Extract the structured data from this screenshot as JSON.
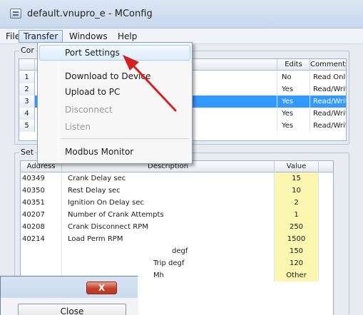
{
  "window": {
    "title": "default.vnupro_e - MConfig"
  },
  "menubar": {
    "items": [
      "File",
      "Transfer",
      "Windows",
      "Help"
    ]
  },
  "config_group": {
    "label": "Cor",
    "columns": {
      "edits": "Edits",
      "comments": "Comments"
    },
    "rows": [
      {
        "num": "1",
        "edits": "No",
        "comments": "Read Only"
      },
      {
        "num": "2",
        "edits": "Yes",
        "comments": "Read/Write"
      },
      {
        "num": "3",
        "edits": "Yes",
        "comments": "Read/Write"
      },
      {
        "num": "4",
        "edits": "Yes",
        "comments": "Read/Write"
      },
      {
        "num": "5",
        "edits": "Yes",
        "comments": "Read/Write"
      }
    ]
  },
  "settings_group": {
    "label": "Set",
    "columns": {
      "address": "Address",
      "description": "Description",
      "value": "Value"
    },
    "rows": [
      {
        "address": "40349",
        "description": "Crank Delay sec",
        "value": "15"
      },
      {
        "address": "40350",
        "description": "Rest Delay sec",
        "value": "10"
      },
      {
        "address": "40351",
        "description": "Ignition On Delay sec",
        "value": "2"
      },
      {
        "address": "40207",
        "description": "Number of Crank Attempts",
        "value": "1"
      },
      {
        "address": "40208",
        "description": "Crank Disconnect RPM",
        "value": "250"
      },
      {
        "address": "40214",
        "description": "Load Perm RPM",
        "value": "1500"
      },
      {
        "address": "",
        "description": "degf",
        "value": "150"
      },
      {
        "address": "",
        "description": "Trip degf",
        "value": "120"
      },
      {
        "address": "",
        "description": "Mh",
        "value": "Other"
      }
    ]
  },
  "transfer_menu": {
    "items": [
      {
        "label": "Port Settings",
        "state": "hover"
      },
      {
        "label": "Download to Device",
        "state": "enabled"
      },
      {
        "label": "Upload to PC",
        "state": "enabled"
      },
      {
        "label": "Disconnect",
        "state": "disabled"
      },
      {
        "label": "Listen",
        "state": "disabled"
      },
      {
        "label": "Modbus Monitor",
        "state": "enabled"
      }
    ]
  },
  "dialog": {
    "close_glyph": "X",
    "button_label": "Close"
  },
  "colors": {
    "selection": "#3399ff",
    "value_highlight": "#fbf6b0",
    "arrow": "#d42020",
    "close_button": "#c8412a"
  }
}
